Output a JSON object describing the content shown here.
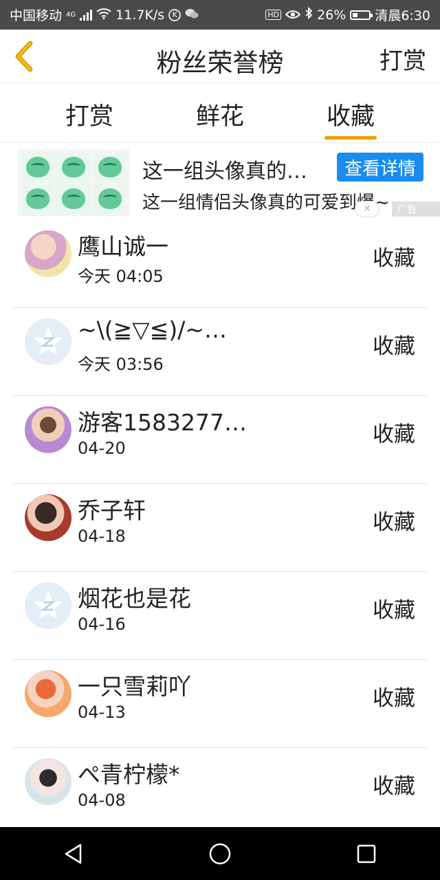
{
  "status_bar": {
    "carrier": "中国移动",
    "network": "4G",
    "speed": "11.7K/s",
    "k_icon_letter": "K",
    "hd": "HD",
    "battery": "26%",
    "time": "清晨6:30"
  },
  "header": {
    "title": "粉丝荣誉榜",
    "reward_button": "打赏"
  },
  "tabs": [
    {
      "label": "打赏",
      "active": false
    },
    {
      "label": "鲜花",
      "active": false
    },
    {
      "label": "收藏",
      "active": true
    }
  ],
  "ad": {
    "title": "这一组头像真的…",
    "button": "查看详情",
    "description": "这一组情侣头像真的可爱到爆~",
    "close": "✕",
    "label": "广告"
  },
  "fans": [
    {
      "name": "鹰山诚一",
      "time": "今天 04:05",
      "action": "收藏"
    },
    {
      "name": "~\\(≧▽≦)/~…",
      "time": "今天 03:56",
      "action": "收藏"
    },
    {
      "name": "游客1583277…",
      "time": "04-20",
      "action": "收藏"
    },
    {
      "name": "乔子轩",
      "time": "04-18",
      "action": "收藏"
    },
    {
      "name": "烟花也是花",
      "time": "04-16",
      "action": "收藏"
    },
    {
      "name": "一只雪莉吖",
      "time": "04-13",
      "action": "收藏"
    },
    {
      "name": "ぺ青柠檬*",
      "time": "04-08",
      "action": "收藏"
    }
  ],
  "colors": {
    "status_bar": "#4a4a4a",
    "accent": "#f0a000",
    "ad_button": "#1a8cf0",
    "nav_bar": "#000000"
  },
  "icons": {
    "back": "chevron-left-icon",
    "nav_back": "triangle-back-icon",
    "nav_home": "circle-home-icon",
    "nav_recent": "square-recent-icon"
  }
}
